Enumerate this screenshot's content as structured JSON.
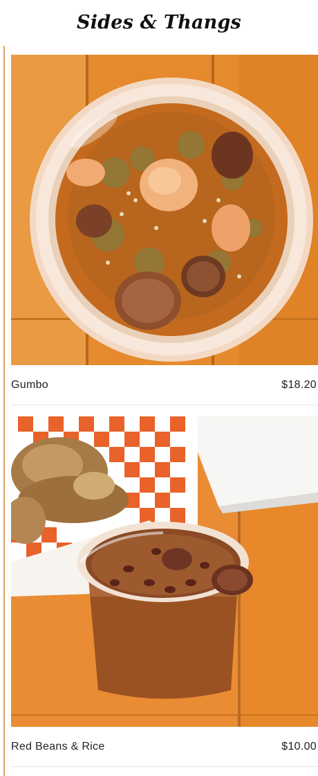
{
  "section": {
    "title": "Sides & Thangs"
  },
  "items": [
    {
      "name": "Gumbo",
      "price": "$18.20",
      "photo_icon": "gumbo-bowl-photo"
    },
    {
      "name": "Red Beans & Rice",
      "price": "$10.00",
      "photo_icon": "red-beans-rice-photo"
    }
  ],
  "colors": {
    "accent": "#e2a25e",
    "table_orange": "#e38a2c",
    "divider": "#e6e6e6"
  }
}
